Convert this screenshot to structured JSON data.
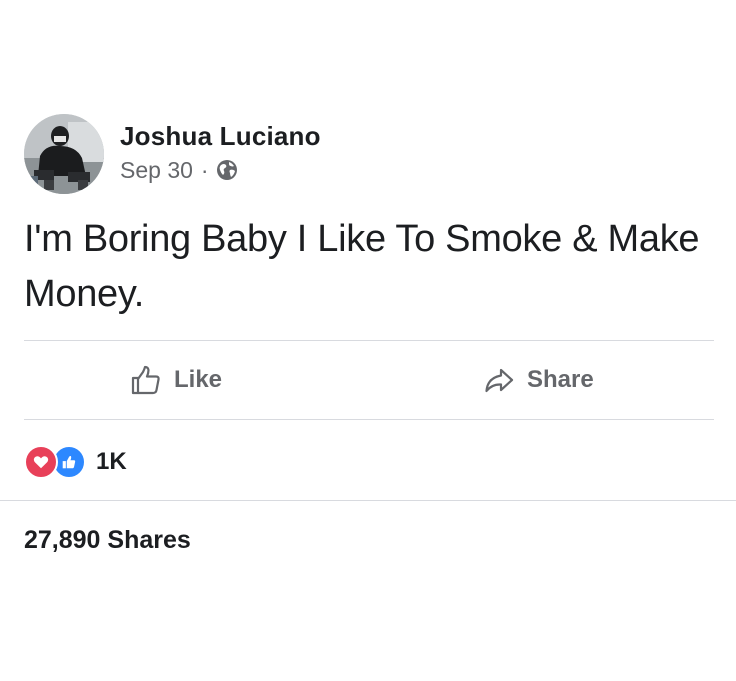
{
  "post": {
    "author": "Joshua Luciano",
    "date": "Sep 30",
    "separator": "·",
    "privacy_icon": "globe-icon",
    "text": "I'm Boring Baby I Like To Smoke & Make Money."
  },
  "actions": {
    "like_label": "Like",
    "share_label": "Share"
  },
  "reactions": {
    "icons": [
      "love-icon",
      "like-icon"
    ],
    "count": "1K"
  },
  "shares": {
    "label": "27,890 Shares"
  },
  "colors": {
    "text": "#1c1e21",
    "secondary": "#65676b",
    "divider": "#d8dadf",
    "love": "#e84059",
    "like": "#2d88ff"
  }
}
